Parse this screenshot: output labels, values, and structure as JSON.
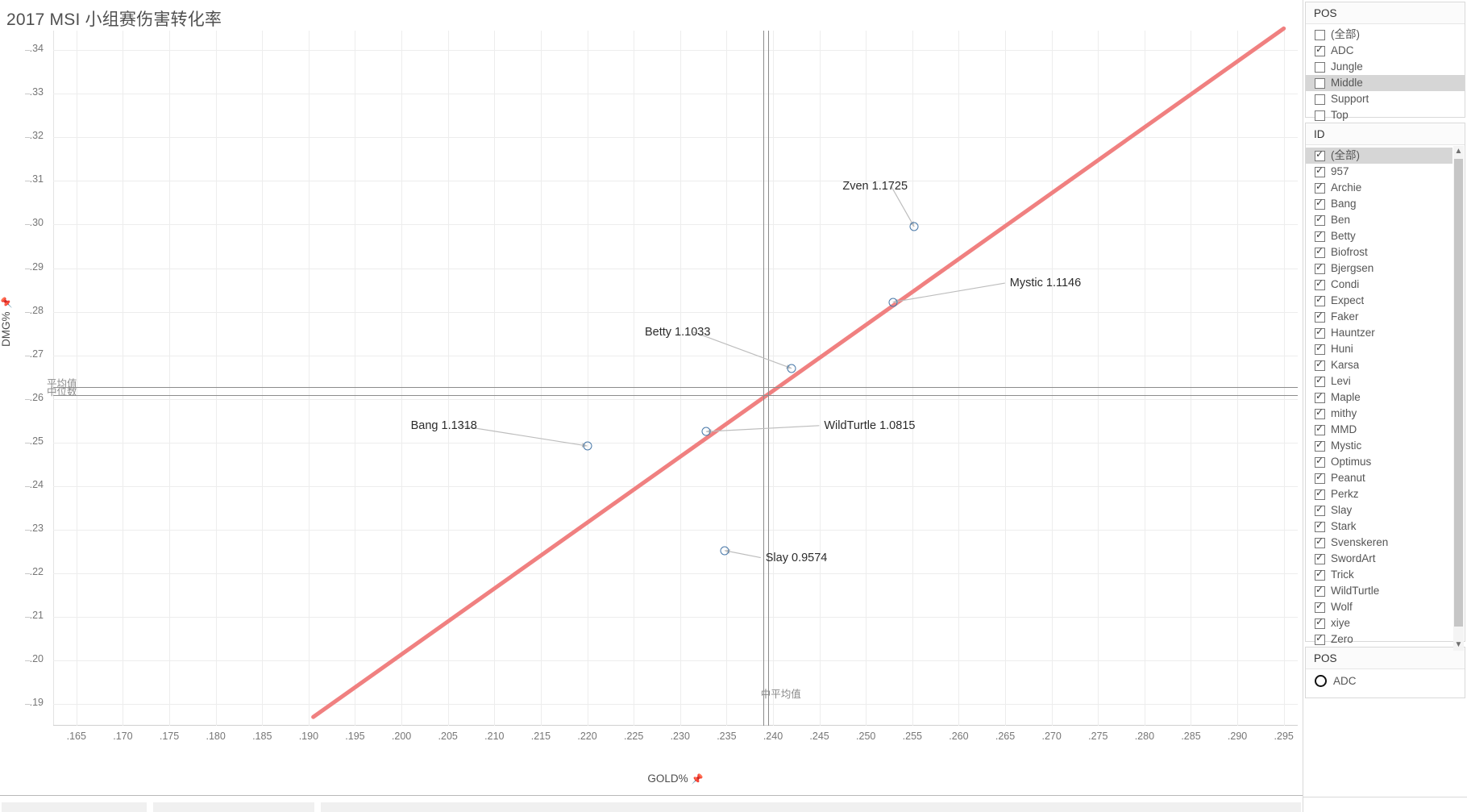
{
  "chart": {
    "title": "2017 MSI 小组赛伤害转化率",
    "x_axis_title": "GOLD%",
    "y_axis_title": "DMG%",
    "pin_icon": "pin-icon"
  },
  "chart_data": {
    "type": "scatter",
    "title": "2017 MSI 小组赛伤害转化率",
    "xlabel": "GOLD%",
    "ylabel": "DMG%",
    "xlim": [
      0.1625,
      0.2965
    ],
    "ylim": [
      0.185,
      0.3445
    ],
    "grid": true,
    "legend_position": "right",
    "xticks": [
      ".165",
      ".170",
      ".175",
      ".180",
      ".185",
      ".190",
      ".195",
      ".200",
      ".205",
      ".210",
      ".215",
      ".220",
      ".225",
      ".230",
      ".235",
      ".240",
      ".245",
      ".250",
      ".255",
      ".260",
      ".265",
      ".270",
      ".275",
      ".280",
      ".285",
      ".290",
      ".295"
    ],
    "yticks": [
      ".19",
      ".20",
      ".21",
      ".22",
      ".23",
      ".24",
      ".25",
      ".26",
      ".27",
      ".28",
      ".29",
      ".30",
      ".31",
      ".32",
      ".33",
      ".34"
    ],
    "points": [
      {
        "label": "Zven 1.1725",
        "name": "Zven",
        "value": 1.1725,
        "x": 0.2552,
        "y": 0.2995,
        "lx": 0.2475,
        "ly": 0.3085
      },
      {
        "label": "Mystic 1.1146",
        "name": "Mystic",
        "value": 1.1146,
        "x": 0.2529,
        "y": 0.2822,
        "lx": 0.2655,
        "ly": 0.2862
      },
      {
        "label": "Betty 1.1033",
        "name": "Betty",
        "value": 1.1033,
        "x": 0.242,
        "y": 0.267,
        "lx": 0.2262,
        "ly": 0.275
      },
      {
        "label": "WildTurtle 1.0815",
        "name": "WildTurtle",
        "value": 1.0815,
        "x": 0.2328,
        "y": 0.2525,
        "lx": 0.2455,
        "ly": 0.2535
      },
      {
        "label": "Bang 1.1318",
        "name": "Bang",
        "value": 1.1318,
        "x": 0.22,
        "y": 0.2492,
        "lx": 0.201,
        "ly": 0.2535
      },
      {
        "label": "Slay 0.9574",
        "name": "Slay",
        "value": 0.9574,
        "x": 0.2348,
        "y": 0.2252,
        "lx": 0.2392,
        "ly": 0.2232
      }
    ],
    "trend_line": {
      "color": "#f08080",
      "x1": 0.1905,
      "y1": 0.187,
      "x2": 0.295,
      "y2": 0.345
    },
    "reference_lines": [
      {
        "label": "平均值",
        "orientation": "horizontal",
        "value": 0.2628
      },
      {
        "label": "中位数",
        "orientation": "horizontal",
        "value": 0.2608
      },
      {
        "label": "中平均值",
        "orientation": "vertical",
        "value": 0.2392
      }
    ]
  },
  "sidebar": {
    "pos_filter": {
      "title": "POS",
      "items": [
        {
          "label": "(全部)",
          "checked": false,
          "selected": false
        },
        {
          "label": "ADC",
          "checked": true,
          "selected": false
        },
        {
          "label": "Jungle",
          "checked": false,
          "selected": false
        },
        {
          "label": "Middle",
          "checked": false,
          "selected": true
        },
        {
          "label": "Support",
          "checked": false,
          "selected": false
        },
        {
          "label": "Top",
          "checked": false,
          "selected": false
        }
      ]
    },
    "id_filter": {
      "title": "ID",
      "items": [
        {
          "label": "(全部)",
          "checked": true,
          "selected": true
        },
        {
          "label": "957",
          "checked": true,
          "selected": false
        },
        {
          "label": "Archie",
          "checked": true,
          "selected": false
        },
        {
          "label": "Bang",
          "checked": true,
          "selected": false
        },
        {
          "label": "Ben",
          "checked": true,
          "selected": false
        },
        {
          "label": "Betty",
          "checked": true,
          "selected": false
        },
        {
          "label": "Biofrost",
          "checked": true,
          "selected": false
        },
        {
          "label": "Bjergsen",
          "checked": true,
          "selected": false
        },
        {
          "label": "Condi",
          "checked": true,
          "selected": false
        },
        {
          "label": "Expect",
          "checked": true,
          "selected": false
        },
        {
          "label": "Faker",
          "checked": true,
          "selected": false
        },
        {
          "label": "Hauntzer",
          "checked": true,
          "selected": false
        },
        {
          "label": "Huni",
          "checked": true,
          "selected": false
        },
        {
          "label": "Karsa",
          "checked": true,
          "selected": false
        },
        {
          "label": "Levi",
          "checked": true,
          "selected": false
        },
        {
          "label": "Maple",
          "checked": true,
          "selected": false
        },
        {
          "label": "mithy",
          "checked": true,
          "selected": false
        },
        {
          "label": "MMD",
          "checked": true,
          "selected": false
        },
        {
          "label": "Mystic",
          "checked": true,
          "selected": false
        },
        {
          "label": "Optimus",
          "checked": true,
          "selected": false
        },
        {
          "label": "Peanut",
          "checked": true,
          "selected": false
        },
        {
          "label": "Perkz",
          "checked": true,
          "selected": false
        },
        {
          "label": "Slay",
          "checked": true,
          "selected": false
        },
        {
          "label": "Stark",
          "checked": true,
          "selected": false
        },
        {
          "label": "Svenskeren",
          "checked": true,
          "selected": false
        },
        {
          "label": "SwordArt",
          "checked": true,
          "selected": false
        },
        {
          "label": "Trick",
          "checked": true,
          "selected": false
        },
        {
          "label": "WildTurtle",
          "checked": true,
          "selected": false
        },
        {
          "label": "Wolf",
          "checked": true,
          "selected": false
        },
        {
          "label": "xiye",
          "checked": true,
          "selected": false
        },
        {
          "label": "Zero",
          "checked": true,
          "selected": false
        }
      ],
      "scroll_up_icon": "chevron-up-icon",
      "scroll_down_icon": "chevron-down-icon"
    },
    "legend": {
      "title": "POS",
      "items": [
        {
          "label": "ADC",
          "marker": "circle-outline",
          "color": "#111111"
        }
      ]
    }
  }
}
